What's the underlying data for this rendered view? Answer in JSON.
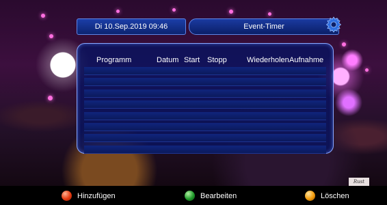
{
  "header": {
    "datetime": "Di 10.Sep.2019 09:46",
    "title": "Event-Timer",
    "icon": "gear-icon"
  },
  "table": {
    "columns": [
      "Programm",
      "Datum",
      "Start",
      "Stopp",
      "Wiederholen",
      "Aufnahme"
    ],
    "rows": [
      "",
      "",
      "",
      "",
      "",
      "",
      "",
      ""
    ]
  },
  "footer": {
    "buttons": [
      {
        "label": "Hinzufügen",
        "color": "#e63a10",
        "icon": "red-button-icon"
      },
      {
        "label": "Bearbeiten",
        "color": "#1f9a2a",
        "icon": "green-button-icon"
      },
      {
        "label": "Löschen",
        "color": "#f29a0a",
        "icon": "orange-button-icon"
      }
    ]
  },
  "background": {
    "corner_label": "Rust"
  }
}
